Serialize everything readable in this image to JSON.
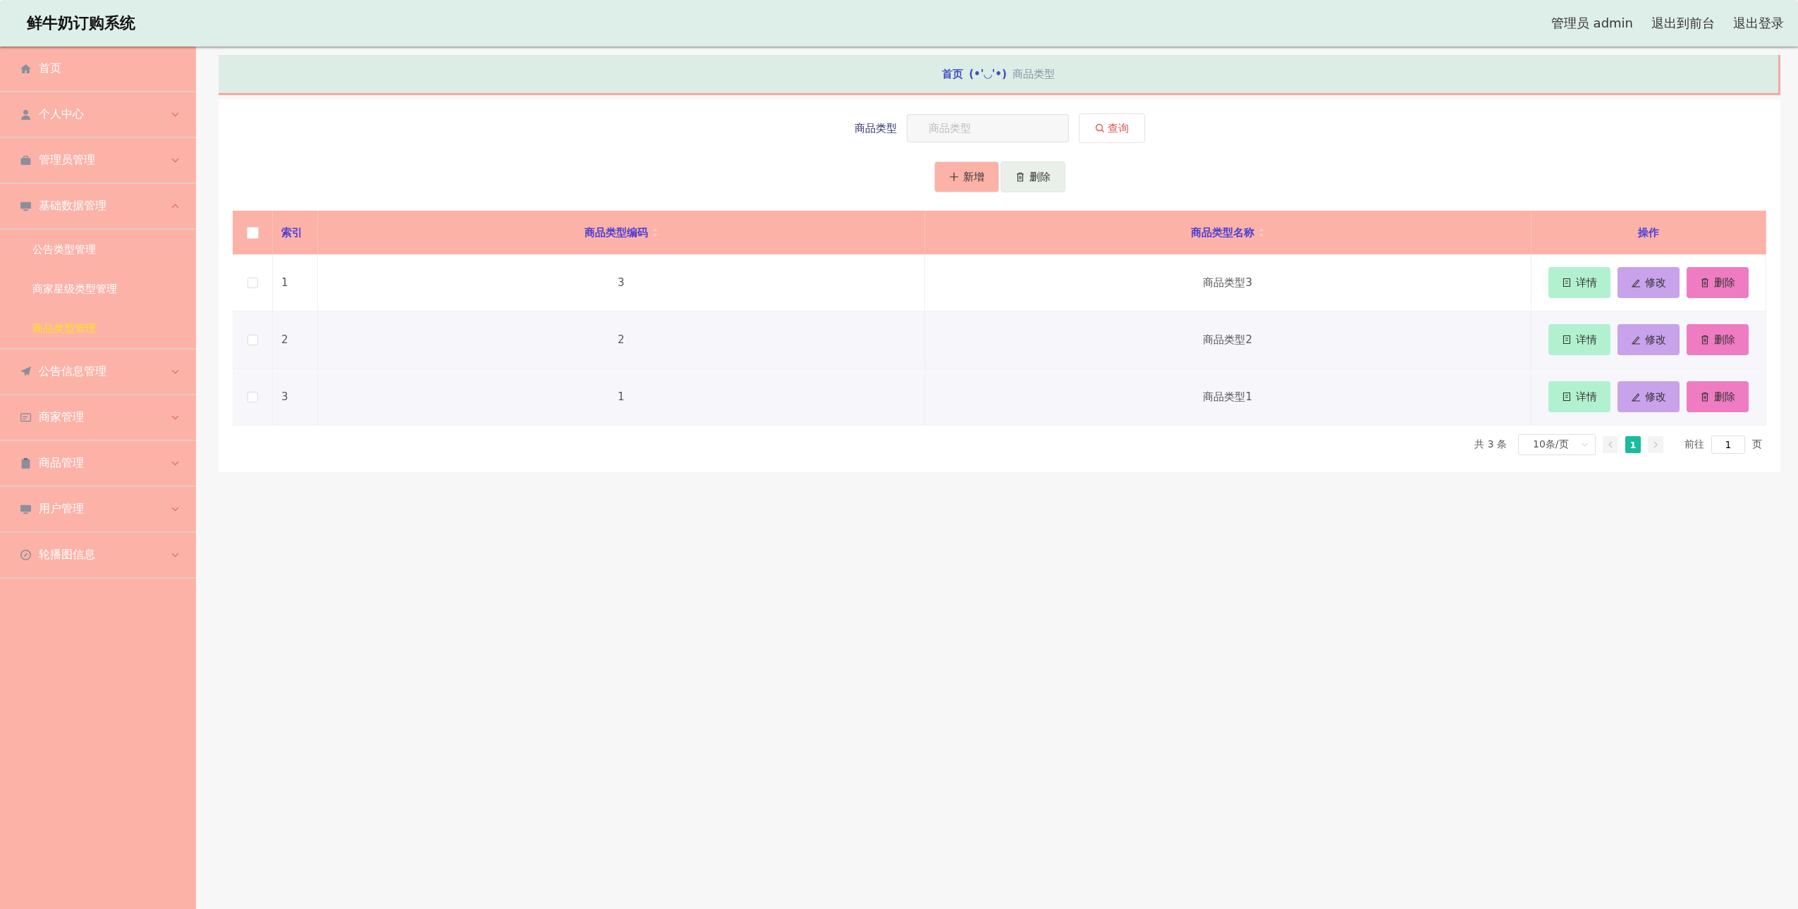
{
  "header": {
    "title": "鲜牛奶订购系统",
    "user": "管理员 admin",
    "links": [
      "退出到前台",
      "退出登录"
    ]
  },
  "sidebar": {
    "items": [
      {
        "label": "首页",
        "kind": "link"
      },
      {
        "label": "个人中心",
        "kind": "submenu",
        "expanded": false
      },
      {
        "label": "管理员管理",
        "kind": "submenu",
        "expanded": false
      },
      {
        "label": "基础数据管理",
        "kind": "submenu",
        "expanded": true,
        "children": [
          {
            "label": "公告类型管理",
            "selected": false
          },
          {
            "label": "商家星级类型管理",
            "selected": false
          },
          {
            "label": "商品类型管理",
            "selected": true
          }
        ]
      },
      {
        "label": "公告信息管理",
        "kind": "submenu",
        "expanded": false
      },
      {
        "label": "商家管理",
        "kind": "submenu",
        "expanded": false
      },
      {
        "label": "商品管理",
        "kind": "submenu",
        "expanded": false
      },
      {
        "label": "用户管理",
        "kind": "submenu",
        "expanded": false
      },
      {
        "label": "轮播图信息",
        "kind": "submenu",
        "expanded": false
      }
    ]
  },
  "breadcrumb": {
    "home": "首页",
    "separator": "(•'◡'•)",
    "current": "商品类型"
  },
  "search": {
    "label": "商品类型",
    "placeholder": "商品类型",
    "button": "查询"
  },
  "actions": {
    "add": "新增",
    "delete": "删除"
  },
  "table": {
    "header_checked": false,
    "columns": [
      "索引",
      "商品类型编码",
      "商品类型名称",
      "操作"
    ],
    "rows": [
      {
        "checked": false,
        "index": "1",
        "code": "3",
        "name": "商品类型3",
        "buttons": [
          "详情",
          "修改",
          "删除"
        ]
      },
      {
        "checked": false,
        "index": "2",
        "code": "2",
        "name": "商品类型2",
        "buttons": [
          "详情",
          "修改",
          "删除"
        ]
      },
      {
        "checked": false,
        "index": "3",
        "code": "1",
        "name": "商品类型1",
        "buttons": [
          "详情",
          "修改",
          "删除"
        ]
      }
    ]
  },
  "pagination": {
    "total": "共 3 条",
    "page_size": "10条/页",
    "pages": [
      {
        "label": "1",
        "selected": true
      }
    ],
    "goto": "前往",
    "goto_value": "1",
    "page_unit": "页"
  }
}
